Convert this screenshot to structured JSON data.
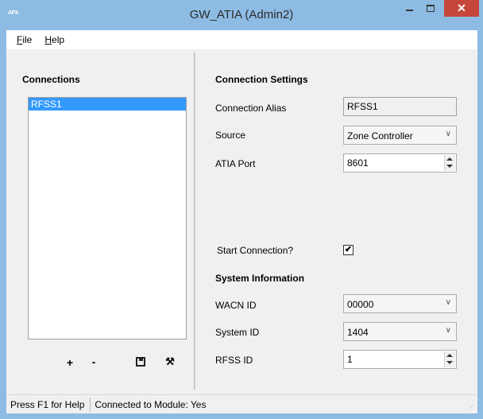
{
  "window": {
    "title": "GW_ATIA (Admin2)",
    "app_icon_text": "APX",
    "close_glyph": "✕"
  },
  "menu": {
    "file": {
      "underline": "F",
      "rest": "ile"
    },
    "help": {
      "underline": "H",
      "rest": "elp"
    }
  },
  "connections": {
    "heading": "Connections",
    "items": [
      "RFSS1"
    ],
    "selected_index": 0,
    "toolbar": {
      "add_glyph": "+",
      "remove_glyph": "-",
      "save_icon": "save-icon",
      "settings_icon": "wrench-icon",
      "settings_glyph": "⚒"
    }
  },
  "connection_settings": {
    "heading": "Connection Settings",
    "alias_label": "Connection Alias",
    "alias_value": "RFSS1",
    "source_label": "Source",
    "source_value": "Zone Controller",
    "port_label": "ATIA Port",
    "port_value": "8601",
    "start_label": "Start Connection?",
    "start_checked": true,
    "check_glyph": "✔"
  },
  "system_information": {
    "heading": "System Information",
    "wacn_label": "WACN ID",
    "wacn_value": "00000",
    "system_label": "System ID",
    "system_value": "1404",
    "rfss_label": "RFSS ID",
    "rfss_value": "1"
  },
  "status": {
    "help_text": "Press F1 for Help",
    "module_text": "Connected to Module: Yes"
  },
  "colors": {
    "titlebar": "#8dbbe3",
    "close_button": "#c7463c",
    "selection": "#3399ff"
  }
}
